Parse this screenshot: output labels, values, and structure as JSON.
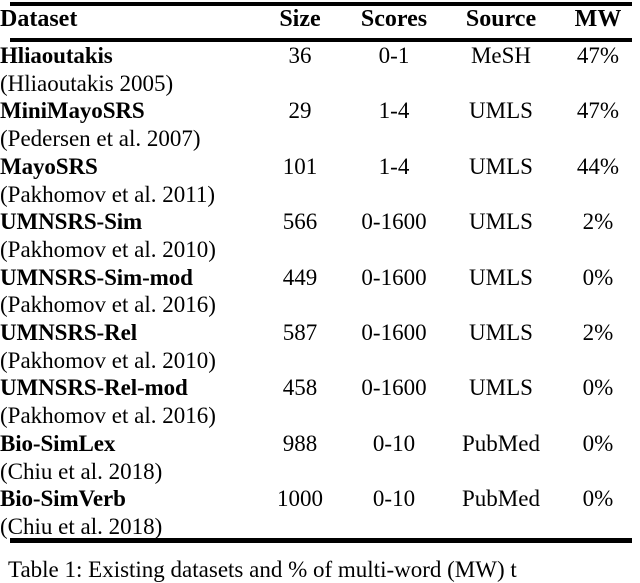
{
  "table": {
    "columns": [
      {
        "key": "dataset",
        "label": "Dataset",
        "align": "left"
      },
      {
        "key": "size",
        "label": "Size",
        "align": "center"
      },
      {
        "key": "scores",
        "label": "Scores",
        "align": "center"
      },
      {
        "key": "source",
        "label": "Source",
        "align": "center"
      },
      {
        "key": "mw",
        "label": "MW",
        "align": "center"
      }
    ],
    "rows": [
      {
        "dataset": "Hliaoutakis",
        "citation": "(Hliaoutakis 2005)",
        "size": "36",
        "scores": "0-1",
        "source": "MeSH",
        "mw": "47%"
      },
      {
        "dataset": "MiniMayoSRS",
        "citation": "(Pedersen et al. 2007)",
        "size": "29",
        "scores": "1-4",
        "source": "UMLS",
        "mw": "47%"
      },
      {
        "dataset": "MayoSRS",
        "citation": "(Pakhomov et al. 2011)",
        "size": "101",
        "scores": "1-4",
        "source": "UMLS",
        "mw": "44%"
      },
      {
        "dataset": "UMNSRS-Sim",
        "citation": "(Pakhomov et al. 2010)",
        "size": "566",
        "scores": "0-1600",
        "source": "UMLS",
        "mw": "2%"
      },
      {
        "dataset": "UMNSRS-Sim-mod",
        "citation": "(Pakhomov et al. 2016)",
        "size": "449",
        "scores": "0-1600",
        "source": "UMLS",
        "mw": "0%"
      },
      {
        "dataset": "UMNSRS-Rel",
        "citation": "(Pakhomov et al. 2010)",
        "size": "587",
        "scores": "0-1600",
        "source": "UMLS",
        "mw": "2%"
      },
      {
        "dataset": "UMNSRS-Rel-mod",
        "citation": "(Pakhomov et al. 2016)",
        "size": "458",
        "scores": "0-1600",
        "source": "UMLS",
        "mw": "0%"
      },
      {
        "dataset": "Bio-SimLex",
        "citation": "(Chiu et al. 2018)",
        "size": "988",
        "scores": "0-10",
        "source": "PubMed",
        "mw": "0%"
      },
      {
        "dataset": "Bio-SimVerb",
        "citation": "(Chiu et al. 2018)",
        "size": "1000",
        "scores": "0-10",
        "source": "PubMed",
        "mw": "0%"
      }
    ]
  },
  "caption": {
    "text": "Table 1: Existing datasets and % of multi-word (MW) t"
  }
}
